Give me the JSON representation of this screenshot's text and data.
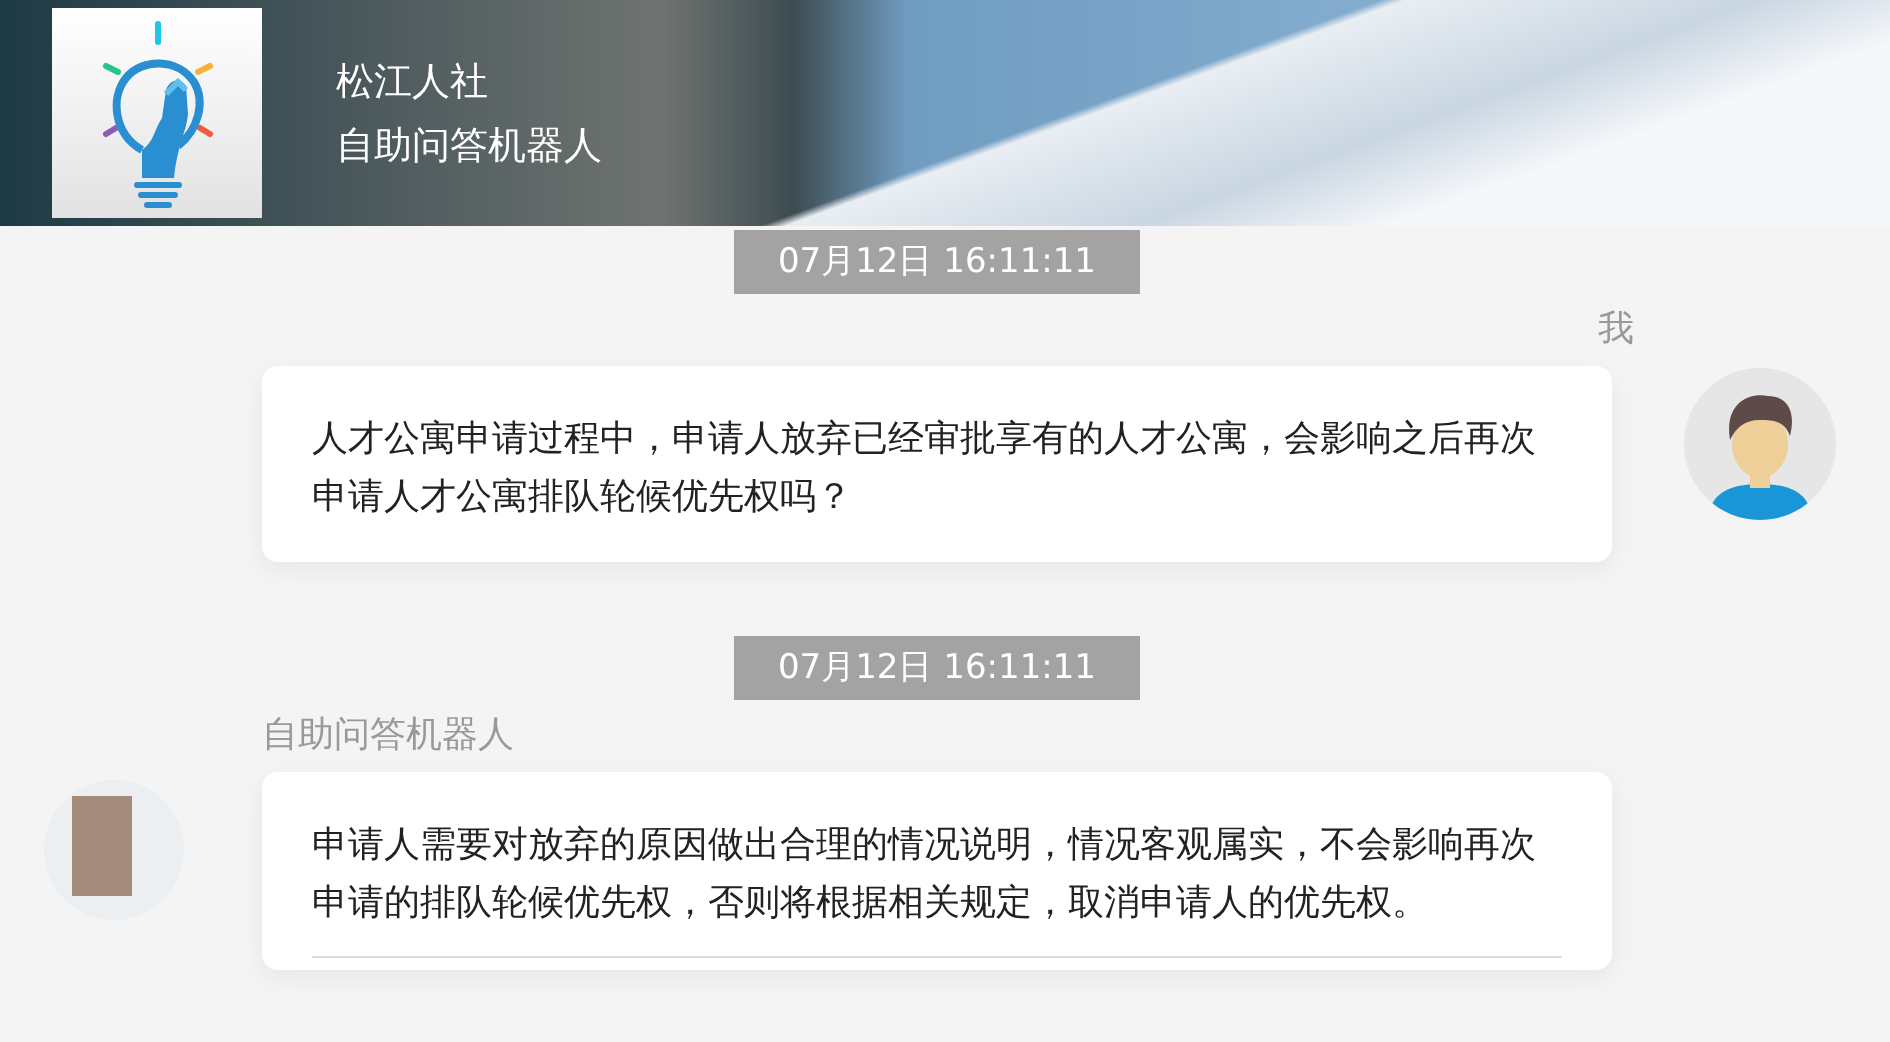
{
  "header": {
    "organization": "松江人社",
    "title": "自助问答机器人"
  },
  "messages": [
    {
      "kind": "user",
      "time": "07月12日 16:11:11",
      "sender": "我",
      "text": "人才公寓申请过程中，申请人放弃已经审批享有的人才公寓，会影响之后再次申请人才公寓排队轮候优先权吗？"
    },
    {
      "kind": "bot",
      "time": "07月12日 16:11:11",
      "sender": "自助问答机器人",
      "text": "申请人需要对放弃的原因做出合理的情况说明，情况客观属实，不会影响再次申请的排队轮候优先权，否则将根据相关规定，取消申请人的优先权。"
    }
  ]
}
